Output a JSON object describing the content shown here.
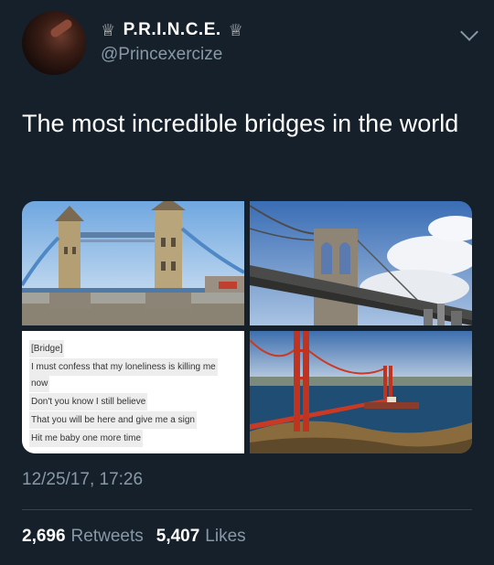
{
  "author": {
    "display_name": "P.R.I.N.C.E.",
    "crown_glyph": "♕",
    "handle": "@Princexercize"
  },
  "tweet": {
    "text": "The most incredible bridges in the world"
  },
  "media": {
    "tiles": [
      {
        "name": "tower-bridge-photo"
      },
      {
        "name": "brooklyn-bridge-photo"
      },
      {
        "name": "lyrics-text-image",
        "lines": [
          "[Bridge]",
          "I must confess that my loneliness is killing me",
          "now",
          "Don't you know I still believe",
          "That you will be here and give me a sign",
          "Hit me baby one more time"
        ]
      },
      {
        "name": "golden-gate-bridge-photo"
      }
    ]
  },
  "meta": {
    "timestamp": "12/25/17, 17:26"
  },
  "stats": {
    "retweets_count": "2,696",
    "retweets_label": "Retweets",
    "likes_count": "5,407",
    "likes_label": "Likes"
  },
  "colors": {
    "background": "#15202b",
    "text_primary": "#ffffff",
    "text_secondary": "#8899a6",
    "divider": "#38444d"
  }
}
